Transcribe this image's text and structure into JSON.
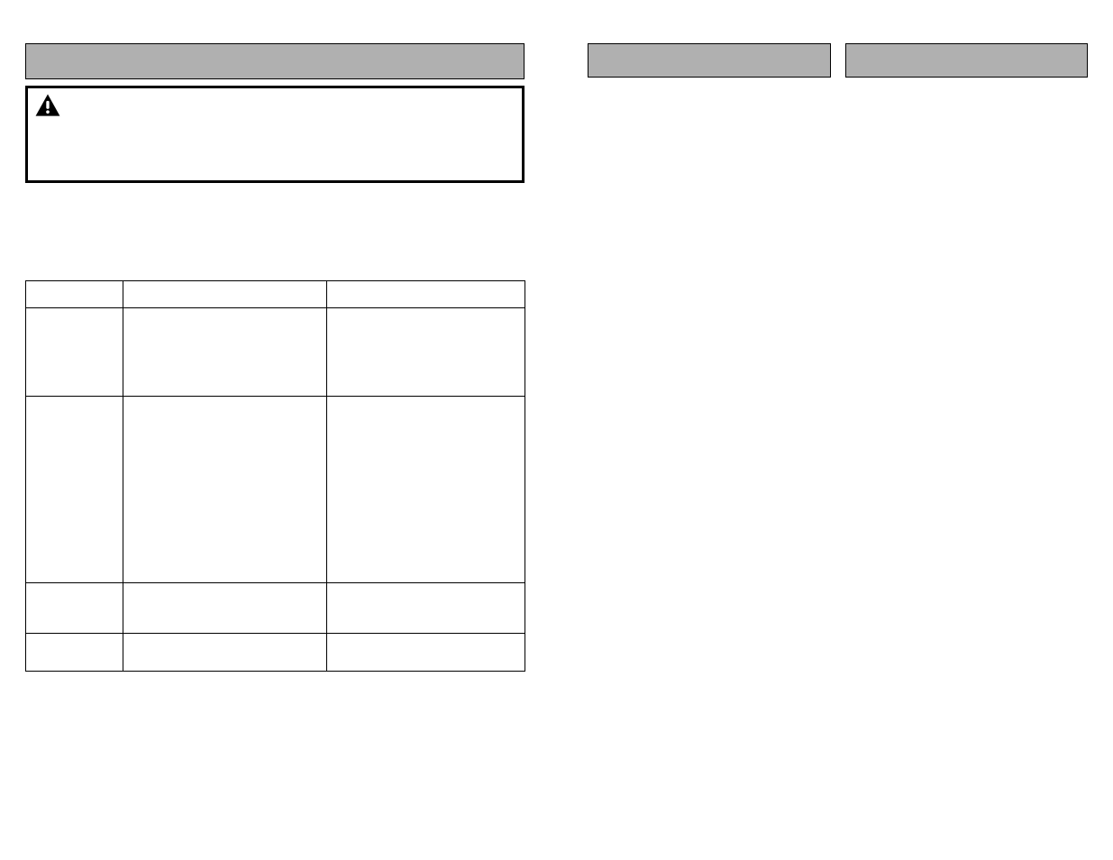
{
  "left": {
    "header": "",
    "warning": {
      "text": ""
    },
    "table": {
      "headers": [
        "",
        "",
        ""
      ],
      "rows": [
        [
          "",
          "",
          ""
        ],
        [
          "",
          "",
          ""
        ],
        [
          "",
          "",
          ""
        ],
        [
          "",
          "",
          ""
        ]
      ]
    }
  },
  "mid": {
    "header": ""
  },
  "right": {
    "header": ""
  }
}
